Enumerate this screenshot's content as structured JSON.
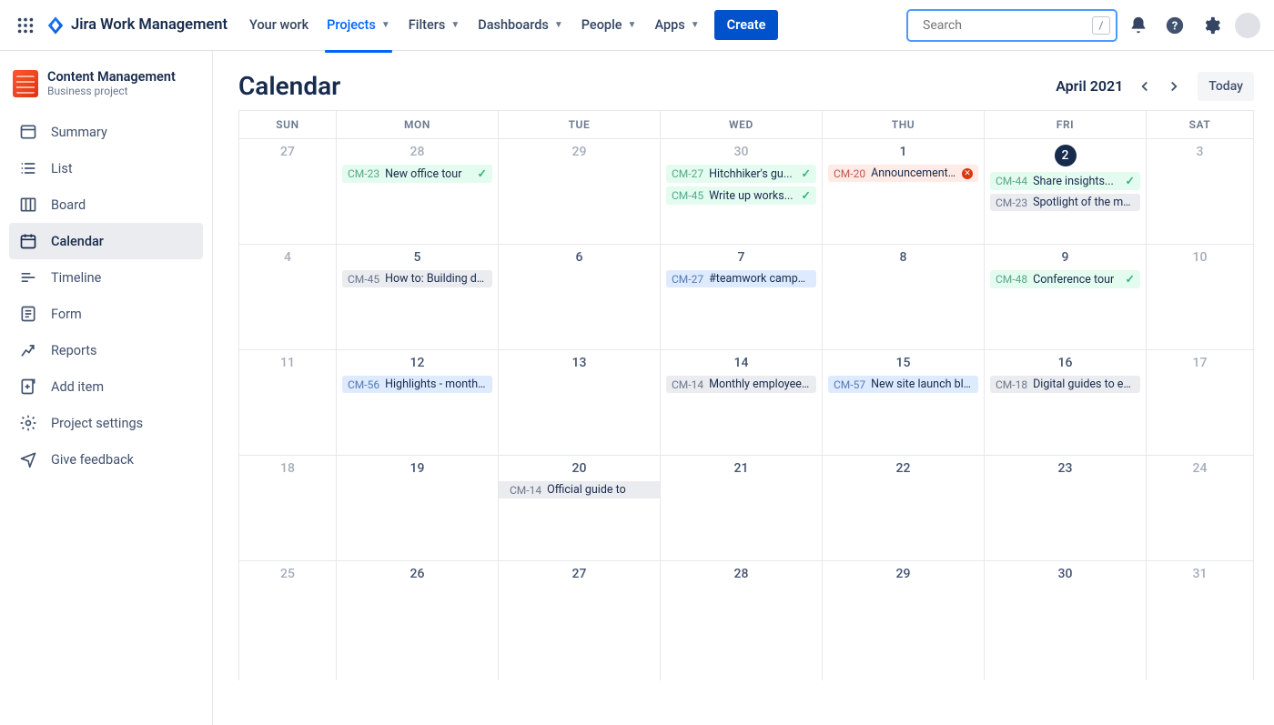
{
  "brand": "Jira Work Management",
  "nav": {
    "items": [
      {
        "label": "Your work",
        "dropdown": false
      },
      {
        "label": "Projects",
        "dropdown": true,
        "active": true
      },
      {
        "label": "Filters",
        "dropdown": true
      },
      {
        "label": "Dashboards",
        "dropdown": true
      },
      {
        "label": "People",
        "dropdown": true
      },
      {
        "label": "Apps",
        "dropdown": true
      }
    ],
    "create": "Create",
    "search_placeholder": "Search",
    "search_shortcut": "/"
  },
  "project": {
    "name": "Content Management",
    "type": "Business project"
  },
  "sidebar": [
    {
      "key": "summary",
      "label": "Summary"
    },
    {
      "key": "list",
      "label": "List"
    },
    {
      "key": "board",
      "label": "Board"
    },
    {
      "key": "calendar",
      "label": "Calendar",
      "active": true
    },
    {
      "key": "timeline",
      "label": "Timeline"
    },
    {
      "key": "form",
      "label": "Form"
    },
    {
      "key": "reports",
      "label": "Reports"
    },
    {
      "key": "add",
      "label": "Add item"
    },
    {
      "key": "settings",
      "label": "Project settings"
    },
    {
      "key": "feedback",
      "label": "Give feedback"
    }
  ],
  "view": {
    "title": "Calendar",
    "month": "April 2021",
    "today": "Today"
  },
  "dow": [
    "SUN",
    "MON",
    "TUE",
    "WED",
    "THU",
    "FRI",
    "SAT"
  ],
  "cells": [
    [
      {
        "n": "27",
        "out": true
      },
      {
        "n": "28",
        "out": true,
        "events": [
          {
            "c": "green",
            "key": "CM-23",
            "label": "New office tour",
            "done": true
          }
        ]
      },
      {
        "n": "29",
        "out": true
      },
      {
        "n": "30",
        "out": true,
        "events": [
          {
            "c": "green",
            "key": "CM-27",
            "label": "Hitchhiker's gu...",
            "done": true
          },
          {
            "c": "green",
            "key": "CM-45",
            "label": "Write up works...",
            "done": true
          }
        ]
      },
      {
        "n": "1",
        "events": [
          {
            "c": "red",
            "key": "CM-20",
            "label": "Announcement b..",
            "err": true
          }
        ]
      },
      {
        "n": "2",
        "today": true,
        "events": [
          {
            "c": "green",
            "key": "CM-44",
            "label": "Share insights...",
            "done": true
          },
          {
            "c": "gray",
            "key": "CM-23",
            "label": "Spotlight of the mo..."
          }
        ]
      },
      {
        "n": "3",
        "out": true
      }
    ],
    [
      {
        "n": "4",
        "out": true
      },
      {
        "n": "5",
        "events": [
          {
            "c": "gray",
            "key": "CM-45",
            "label": "How to: Building des"
          }
        ]
      },
      {
        "n": "6"
      },
      {
        "n": "7",
        "events": [
          {
            "c": "blue",
            "key": "CM-27",
            "label": "#teamwork campaign"
          }
        ]
      },
      {
        "n": "8"
      },
      {
        "n": "9",
        "events": [
          {
            "c": "green",
            "key": "CM-48",
            "label": "Conference tour",
            "done": true
          }
        ]
      },
      {
        "n": "10",
        "out": true
      }
    ],
    [
      {
        "n": "11",
        "out": true
      },
      {
        "n": "12",
        "events": [
          {
            "c": "blue",
            "key": "CM-56",
            "label": "Highlights - month of"
          }
        ]
      },
      {
        "n": "13"
      },
      {
        "n": "14",
        "events": [
          {
            "c": "gray",
            "key": "CM-14",
            "label": "Monthly employee ..."
          }
        ]
      },
      {
        "n": "15",
        "events": [
          {
            "c": "blue",
            "key": "CM-57",
            "label": "New site launch blog"
          }
        ]
      },
      {
        "n": "16",
        "events": [
          {
            "c": "gray",
            "key": "CM-18",
            "label": "Digital guides to ex..."
          }
        ]
      },
      {
        "n": "17",
        "out": true
      }
    ],
    [
      {
        "n": "18",
        "out": true
      },
      {
        "n": "19"
      },
      {
        "n": "20",
        "events": [
          {
            "c": "gray ov",
            "key": "CM-14",
            "label": "Official guide to"
          }
        ]
      },
      {
        "n": "21"
      },
      {
        "n": "22"
      },
      {
        "n": "23"
      },
      {
        "n": "24",
        "out": true
      }
    ],
    [
      {
        "n": "25",
        "out": true
      },
      {
        "n": "26"
      },
      {
        "n": "27"
      },
      {
        "n": "28"
      },
      {
        "n": "29"
      },
      {
        "n": "30"
      },
      {
        "n": "31",
        "out": true
      }
    ]
  ]
}
